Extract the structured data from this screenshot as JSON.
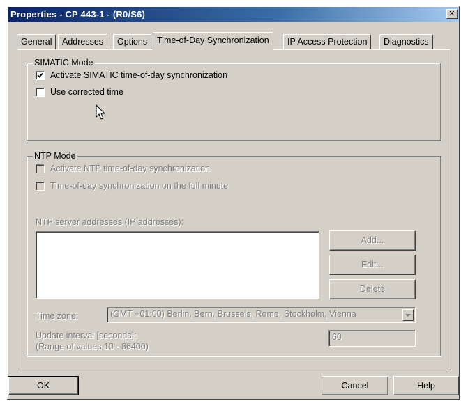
{
  "window": {
    "title": "Properties - CP 443-1 - (R0/S6)",
    "close_glyph": "✕"
  },
  "tabs": [
    {
      "label": "General"
    },
    {
      "label": "Addresses"
    },
    {
      "label": "Options"
    },
    {
      "label": "Time-of-Day Synchronization"
    },
    {
      "label": "IP Access Protection"
    },
    {
      "label": "Diagnostics"
    }
  ],
  "active_tab": "Time-of-Day Synchronization",
  "simatic": {
    "title": "SIMATIC Mode",
    "activate_label": "Activate SIMATIC time-of-day synchronization",
    "activate_checked": true,
    "corrected_label": "Use corrected time",
    "corrected_checked": false
  },
  "ntp": {
    "title": "NTP Mode",
    "activate_label": "Activate NTP time-of-day synchronization",
    "fullminute_label": "Time-of-day synchronization on the full minute",
    "servers_label": "NTP server addresses (IP addresses):",
    "add_label": "Add...",
    "edit_label": "Edit...",
    "delete_label": "Delete",
    "timezone_label": "Time zone:",
    "timezone_value": "(GMT +01:00) Berlin, Bern, Brussels, Rome, Stockholm, Vienna",
    "interval_label_1": "Update interval [seconds]:",
    "interval_label_2": "(Range of values 10 - 86400)",
    "interval_value": "60"
  },
  "footer": {
    "ok_label": "OK",
    "cancel_label": "Cancel",
    "help_label": "Help"
  },
  "icons": {
    "checkmark": "checkmark-icon",
    "dropdown": "chevron-down-icon",
    "cursor": "mouse-cursor-icon"
  },
  "colors": {
    "title_start": "#0a246a",
    "title_end": "#a6caf0",
    "face": "#d4d0c8"
  }
}
